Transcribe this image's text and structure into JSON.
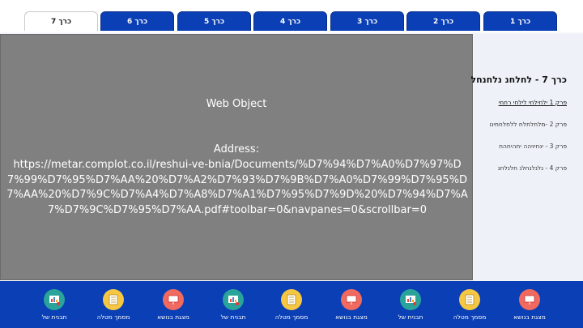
{
  "tabs": [
    {
      "label": "כרך 7",
      "active": true
    },
    {
      "label": "כרך 6",
      "active": false
    },
    {
      "label": "כרך 5",
      "active": false
    },
    {
      "label": "כרך 4",
      "active": false
    },
    {
      "label": "כרך 3",
      "active": false
    },
    {
      "label": "כרך 2",
      "active": false
    },
    {
      "label": "כרך 1",
      "active": false
    }
  ],
  "web_object": {
    "title": "Web Object",
    "address_label": "Address:",
    "address": "https://metar.complot.co.il/reshui-ve-bnia/Documents/%D7%94%D7%A0%D7%97%D7%99%D7%95%D7%AA%20%D7%A2%D7%93%D7%9B%D7%A0%D7%99%D7%95%D7%AA%20%D7%9C%D7%A4%D7%A8%D7%A1%D7%95%D7%9D%20%D7%94%D7%A7%D7%9C%D7%95%D7%AA.pdf#toolbar=0&navpanes=0&scrollbar=0"
  },
  "sidebar": {
    "title": "כרך 7 - לחלחנ נלחנחל",
    "items": [
      {
        "label": "פרק 1 ילחילחי לילחי רחחי"
      },
      {
        "label": "פרק 2 -מלחלחלח ללחלחחינו"
      },
      {
        "label": "פרק 3 - ינחיויהה יחהיחהח"
      },
      {
        "label": "פרק 4 - נלנלנחלנ חלנלחנ"
      }
    ]
  },
  "toolbar": {
    "items": [
      {
        "label": "מצגת בנושא",
        "icon": "presentation-icon",
        "color": "#f06a5f"
      },
      {
        "label": "מסמך מטלה",
        "icon": "document-icon",
        "color": "#f5c742"
      },
      {
        "label": "תבנית של",
        "icon": "chart-template-icon",
        "color": "#2aa39a"
      },
      {
        "label": "מצגת בנושא",
        "icon": "presentation-icon",
        "color": "#f06a5f"
      },
      {
        "label": "מסמך מטלה",
        "icon": "document-icon",
        "color": "#f5c742"
      },
      {
        "label": "תבנית של",
        "icon": "chart-template-icon",
        "color": "#2aa39a"
      },
      {
        "label": "מצגת בנושא",
        "icon": "presentation-icon",
        "color": "#f06a5f"
      },
      {
        "label": "מסמך מטלה",
        "icon": "document-icon",
        "color": "#f5c742"
      },
      {
        "label": "תבנית של",
        "icon": "chart-template-icon",
        "color": "#2aa39a"
      }
    ]
  }
}
